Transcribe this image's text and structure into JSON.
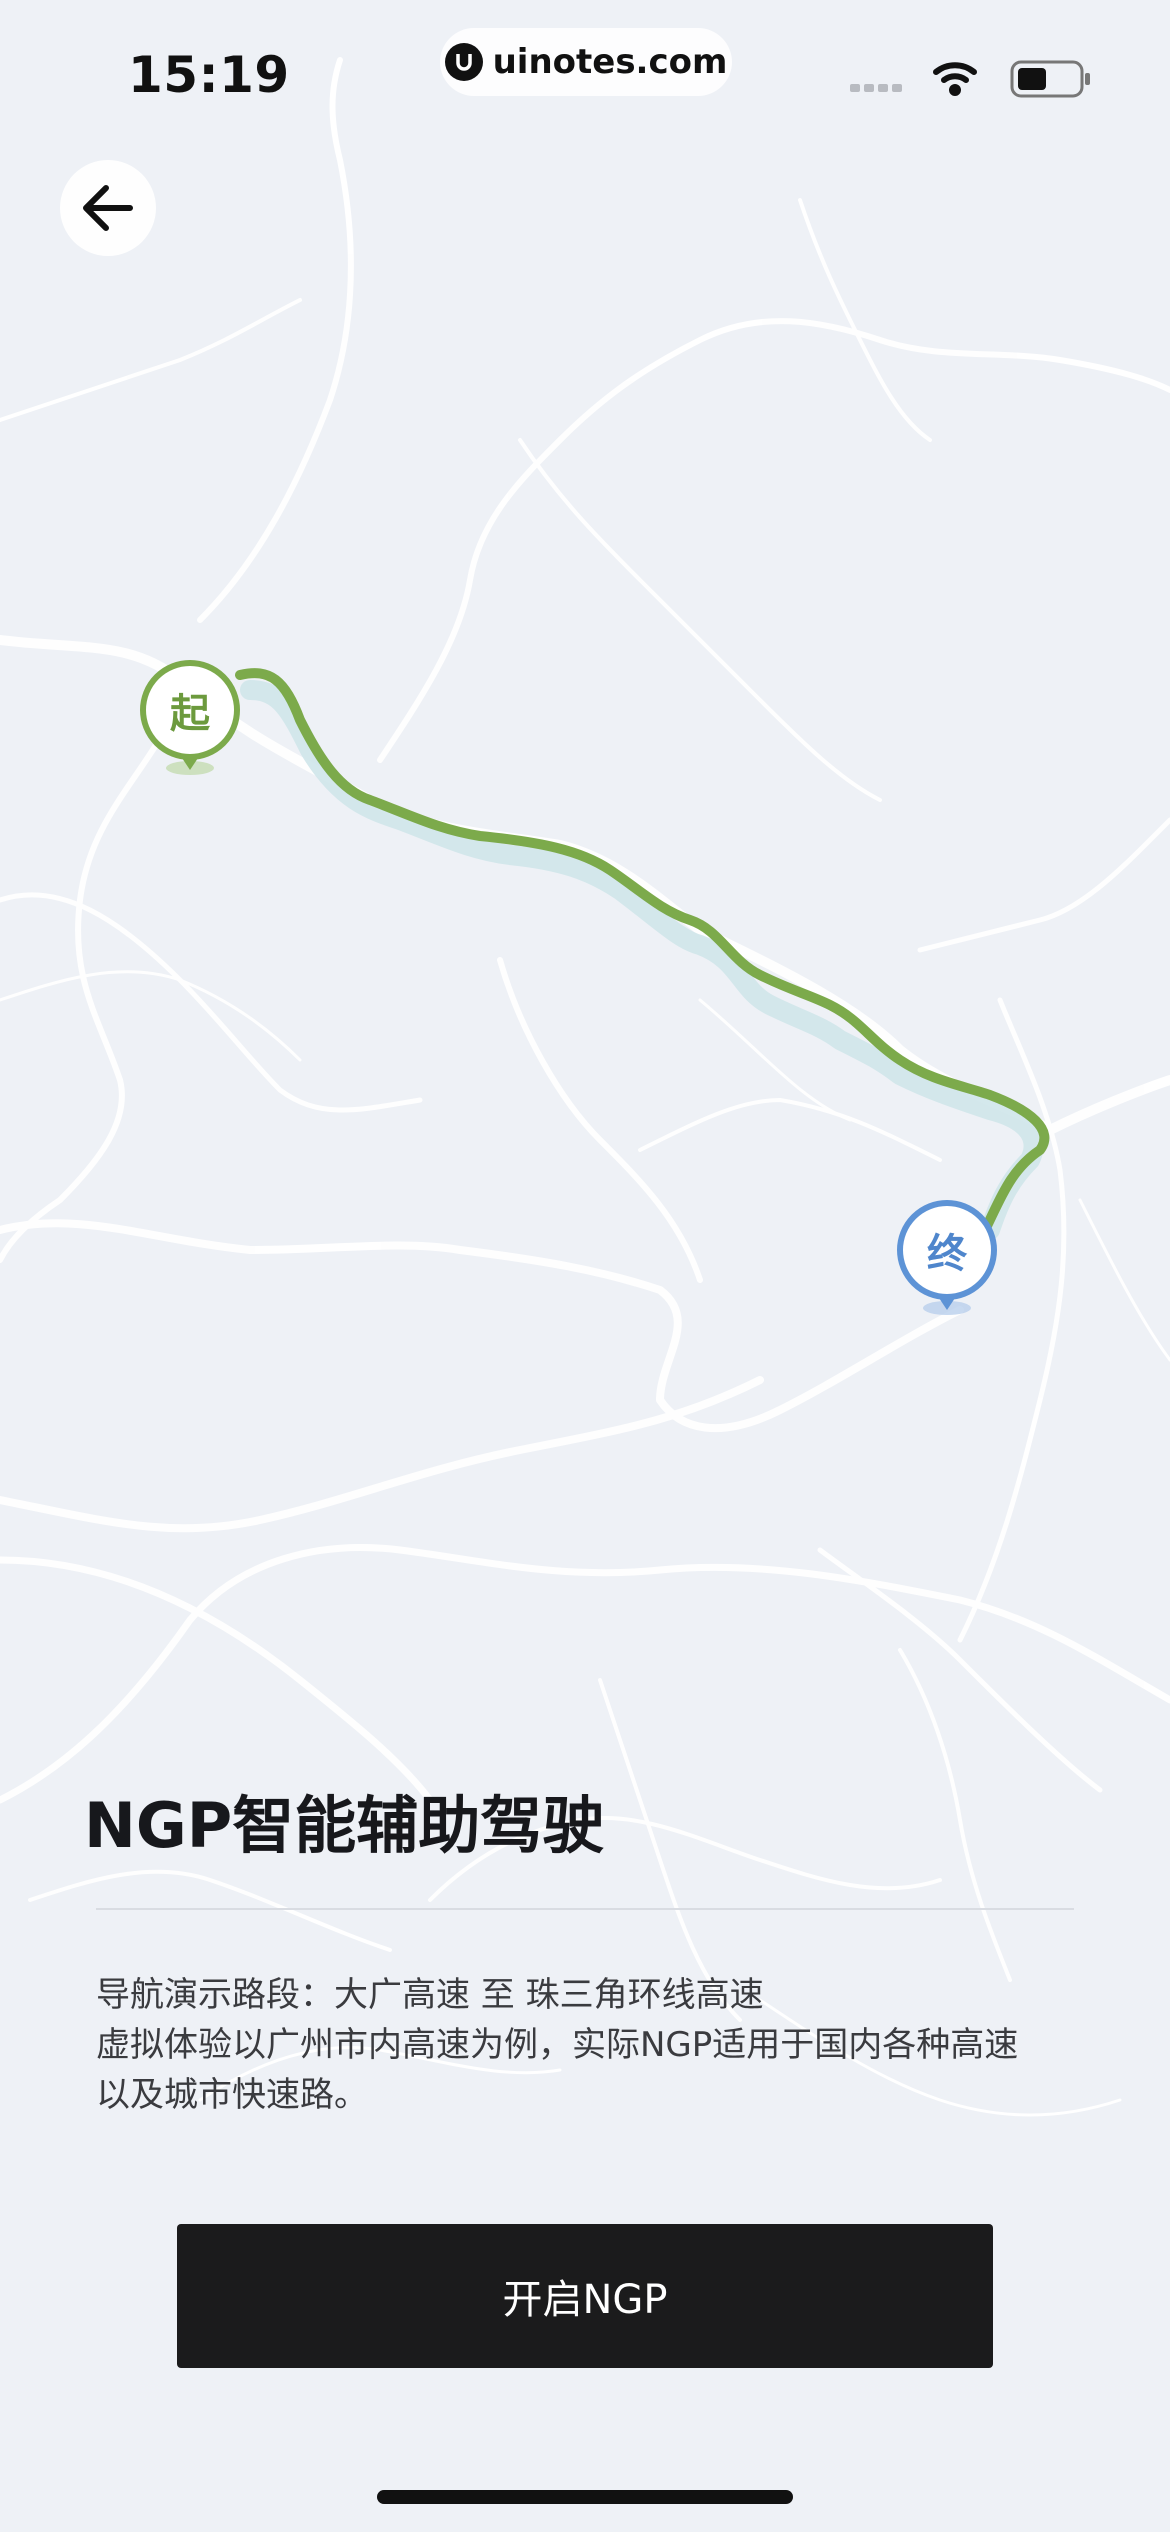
{
  "status_bar": {
    "time": "15:19",
    "url": "uinotes.com",
    "icons": [
      "signal-dots-icon",
      "wifi-icon",
      "battery-icon"
    ]
  },
  "nav": {
    "back_icon": "arrow-left-icon"
  },
  "map": {
    "start_marker": "起",
    "end_marker": "终",
    "route_color": "#7caa4b",
    "start_color": "#7caa4b",
    "end_color": "#5d93d6"
  },
  "title": "NGP智能辅助驾驶",
  "description": {
    "line1": "导航演示路段：大广高速 至 珠三角环线高速",
    "line2": "虚拟体验以广州市内高速为例，实际NGP适用于国内各种高速",
    "line3": "以及城市快速路。"
  },
  "cta": {
    "label": "开启NGP",
    "background": "#1b1b1c"
  }
}
